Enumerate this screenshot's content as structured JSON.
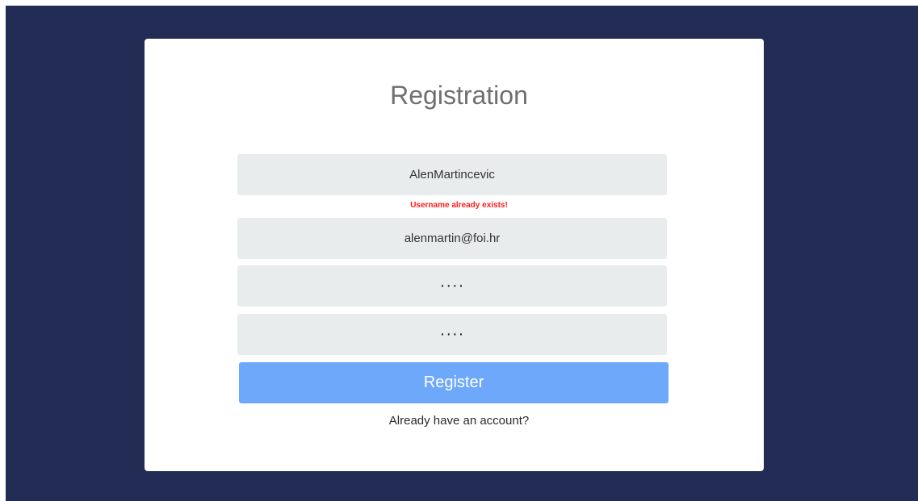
{
  "page": {
    "background_color": "#222c55",
    "card_color": "#ffffff",
    "accent_color": "#6ea8fa",
    "error_color": "#ff1a1a"
  },
  "form": {
    "title": "Registration",
    "username": {
      "value": "AlenMartincevic"
    },
    "username_error": "Username already exists!",
    "email": {
      "value": "alenmartin@foi.hr"
    },
    "password": {
      "value": "····"
    },
    "confirm_password": {
      "value": "····"
    },
    "register_label": "Register",
    "login_link_label": "Already have an account?"
  }
}
